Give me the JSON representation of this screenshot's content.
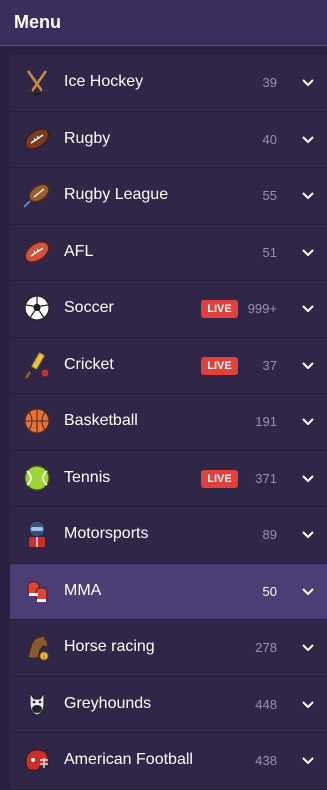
{
  "menu": {
    "title": "Menu",
    "items": [
      {
        "label": "Ice Hockey",
        "count": "39",
        "icon": "ice-hockey-icon"
      },
      {
        "label": "Rugby",
        "count": "40",
        "icon": "rugby-ball-icon"
      },
      {
        "label": "Rugby League",
        "count": "55",
        "icon": "rugby-league-icon"
      },
      {
        "label": "AFL",
        "count": "51",
        "icon": "afl-ball-icon"
      },
      {
        "label": "Soccer",
        "count": "999+",
        "icon": "soccer-ball-icon",
        "live": "LIVE"
      },
      {
        "label": "Cricket",
        "count": "37",
        "icon": "cricket-bat-icon",
        "live": "LIVE"
      },
      {
        "label": "Basketball",
        "count": "191",
        "icon": "basketball-icon"
      },
      {
        "label": "Tennis",
        "count": "371",
        "icon": "tennis-ball-icon",
        "live": "LIVE"
      },
      {
        "label": "Motorsports",
        "count": "89",
        "icon": "racing-driver-icon"
      },
      {
        "label": "MMA",
        "count": "50",
        "icon": "boxing-glove-icon",
        "active": true
      },
      {
        "label": "Horse racing",
        "count": "278",
        "icon": "horse-icon"
      },
      {
        "label": "Greyhounds",
        "count": "448",
        "icon": "greyhound-icon"
      },
      {
        "label": "American Football",
        "count": "438",
        "icon": "football-helmet-icon"
      }
    ]
  },
  "colors": {
    "background": "#2a2142",
    "header": "#3b2e5e",
    "row": "#2f2648",
    "active_row": "#4d3d75",
    "live_badge": "#e0413a",
    "count_text": "#9a91b5"
  }
}
